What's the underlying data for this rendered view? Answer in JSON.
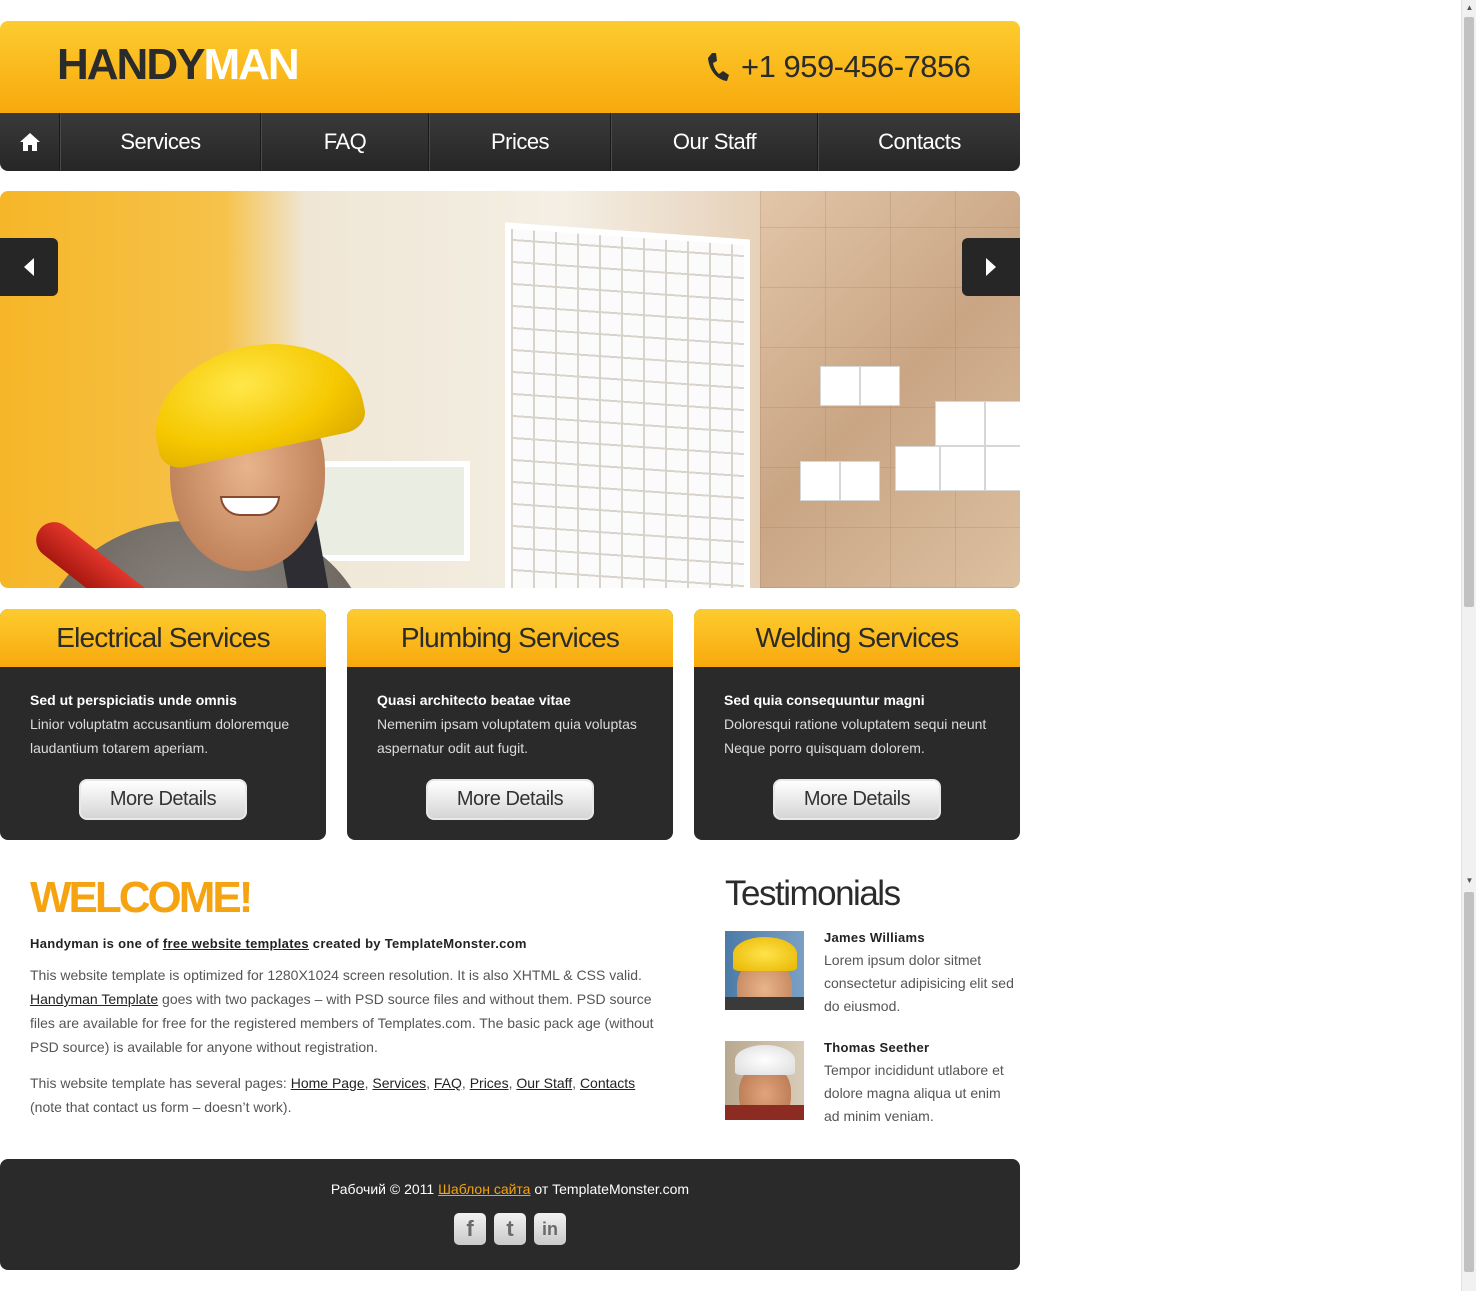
{
  "header": {
    "logo_part1": "HANDY",
    "logo_part2": "MAN",
    "phone": "+1 959-456-7856"
  },
  "nav": {
    "items": [
      {
        "label": "Services"
      },
      {
        "label": "FAQ"
      },
      {
        "label": "Prices"
      },
      {
        "label": "Our Staff"
      },
      {
        "label": "Contacts"
      }
    ]
  },
  "services": [
    {
      "title": "Electrical Services",
      "subtitle": "Sed ut perspiciatis unde omnis",
      "text": "Linior voluptatm accusantium doloremque laudantium totarem aperiam.",
      "button": "More Details"
    },
    {
      "title": "Plumbing Services",
      "subtitle": "Quasi architecto beatae vitae",
      "text": "Nemenim ipsam voluptatem quia voluptas aspernatur odit aut fugit.",
      "button": "More Details"
    },
    {
      "title": "Welding Services",
      "subtitle": "Sed quia consequuntur magni",
      "text": "Doloresqui ratione voluptatem sequi neunt Neque porro quisquam dolorem.",
      "button": "More Details"
    }
  ],
  "welcome": {
    "title": "WELCOME!",
    "lead_before": "Handyman is one of ",
    "lead_link": "free website templates",
    "lead_after": " created by TemplateMonster.com",
    "p1_before": "This website template is optimized for 1280X1024 screen resolution. It is also XHTML & CSS valid. ",
    "p1_link": "Handyman Template",
    "p1_after": " goes with two packages – with PSD source files and without them. PSD source files are available for free for the registered members of Templates.com. The basic pack age (without PSD source) is available for anyone without registration.",
    "p2_before": "This website template has several pages: ",
    "p2_links": [
      "Home Page",
      "Services",
      "FAQ",
      "Prices",
      "Our Staff",
      "Contacts"
    ],
    "p2_after": "(note that contact us form – doesn’t work)."
  },
  "testimonials": {
    "title": "Testimonials",
    "items": [
      {
        "name": "James Williams",
        "text": "Lorem ipsum dolor sitmet consectetur adipisicing elit sed do eiusmod."
      },
      {
        "name": "Thomas Seether",
        "text": "Tempor incididunt utlabore et dolore magna aliqua ut enim ad minim veniam."
      }
    ]
  },
  "footer": {
    "text_before": "Рабочий © 2011 ",
    "link": "Шаблон сайта",
    "text_after": " от TemplateMonster.com",
    "socials": [
      {
        "icon": "facebook-icon",
        "glyph": "f"
      },
      {
        "icon": "twitter-icon",
        "glyph": "t"
      },
      {
        "icon": "linkedin-icon",
        "glyph": "in"
      }
    ]
  },
  "colors": {
    "accent": "#f8a90c",
    "dark": "#2a2a2a"
  }
}
